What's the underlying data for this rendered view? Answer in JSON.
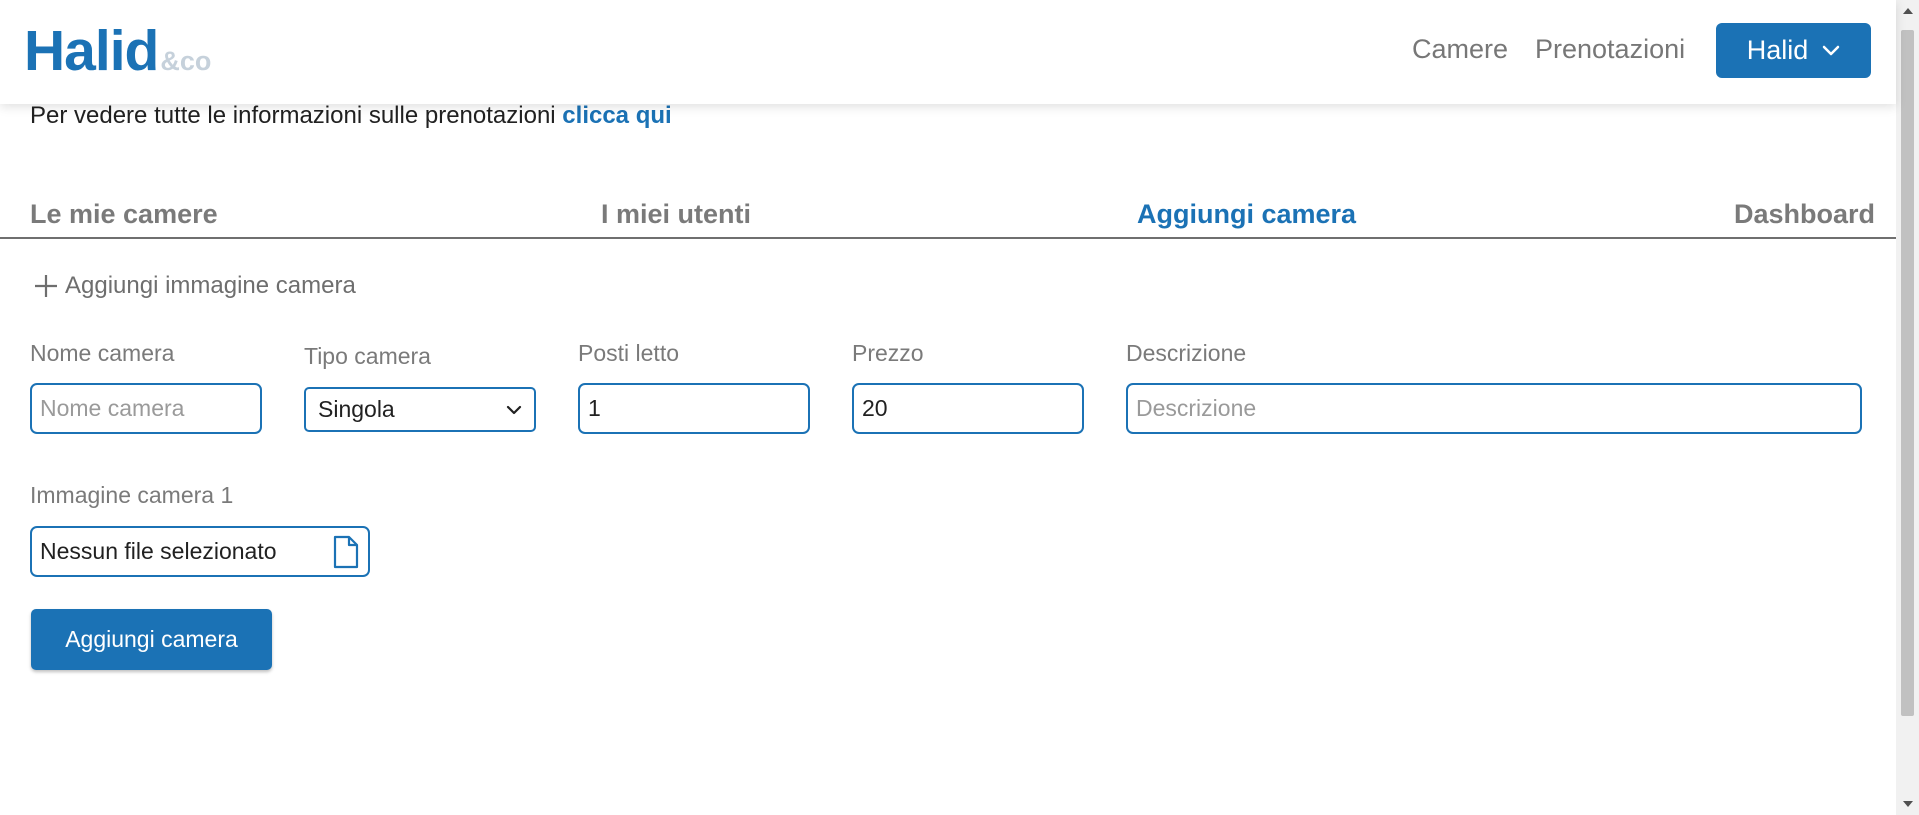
{
  "brand": {
    "name": "Halid",
    "suffix": "&co"
  },
  "nav": {
    "links": [
      "Camere",
      "Prenotazioni"
    ],
    "user_button": "Halid"
  },
  "info": {
    "text": "Per vedere tutte le informazioni sulle prenotazioni ",
    "link": "clicca qui"
  },
  "tabs": [
    {
      "label": "Le mie camere",
      "active": false
    },
    {
      "label": "I miei utenti",
      "active": false
    },
    {
      "label": "Aggiungi camera",
      "active": true
    },
    {
      "label": "Dashboard",
      "active": false
    }
  ],
  "form": {
    "add_image_label": "Aggiungi immagine camera",
    "nome": {
      "label": "Nome camera",
      "placeholder": "Nome camera",
      "value": ""
    },
    "tipo": {
      "label": "Tipo camera",
      "value": "Singola"
    },
    "posti": {
      "label": "Posti letto",
      "value": "1"
    },
    "prezzo": {
      "label": "Prezzo",
      "value": "20"
    },
    "descrizione": {
      "label": "Descrizione",
      "placeholder": "Descrizione",
      "value": ""
    },
    "immagine": {
      "label": "Immagine camera 1",
      "file_text": "Nessun file selezionato"
    },
    "submit_label": "Aggiungi camera"
  },
  "colors": {
    "accent": "#1b72b5",
    "muted_text": "#7a7a7a",
    "brand_suffix": "#c6d1db"
  },
  "icons": [
    "plus-icon",
    "chevron-down-icon",
    "file-icon"
  ]
}
